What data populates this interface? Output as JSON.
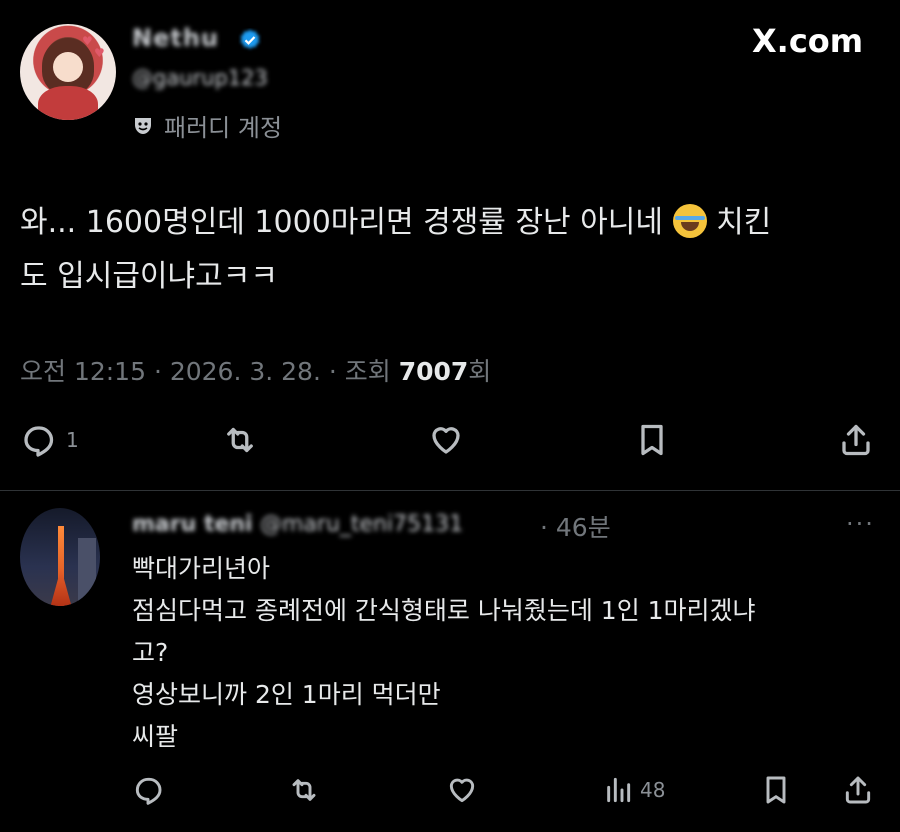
{
  "brand": {
    "site": "X.com"
  },
  "tweet": {
    "author_name": "Nethu",
    "author_handle": "@gaurup123",
    "parody_label": "패러디 계정",
    "parody_icon": "theater-mask-icon",
    "text_line1": "와... 1600명인데 1000마리면 경쟁률 장난 아니네",
    "emoji": "laughing-tears-emoji",
    "text_line1_end": "치킨",
    "text_line2": "도 입시급이냐고ㅋㅋ",
    "meta_prefix": "오전 12:15 · 2026. 3. 28. · 조회 ",
    "views": "7007",
    "views_suffix": "회",
    "reply_count": "1",
    "actions": [
      "reply-icon",
      "retweet-icon",
      "like-icon",
      "bookmark-icon",
      "share-icon"
    ]
  },
  "reply": {
    "author_name": "maru teni",
    "author_handle": "@maru_teni75131",
    "time": "· 46분",
    "more": "···",
    "lines": [
      "빡대가리년아",
      "점심다먹고 종례전에 간식형태로 나눠줬는데 1인 1마리겠냐",
      "고?",
      "영상보니까 2인 1마리 먹더만",
      "씨팔"
    ],
    "views": "48",
    "actions": [
      "reply-icon",
      "retweet-icon",
      "like-icon",
      "views-icon",
      "bookmark-icon",
      "share-icon"
    ]
  },
  "colors": {
    "background": "#000000",
    "text": "#e7e9ea",
    "muted": "#71767b",
    "verified": "#1d9bf0"
  }
}
